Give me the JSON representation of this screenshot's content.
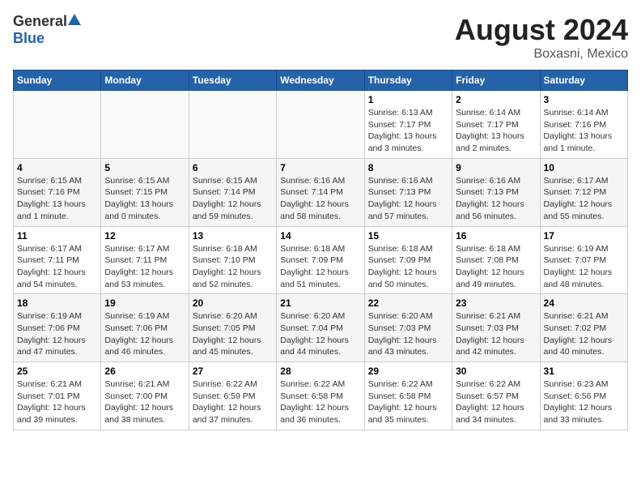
{
  "header": {
    "logo_general": "General",
    "logo_blue": "Blue",
    "month": "August 2024",
    "location": "Boxasni, Mexico"
  },
  "weekdays": [
    "Sunday",
    "Monday",
    "Tuesday",
    "Wednesday",
    "Thursday",
    "Friday",
    "Saturday"
  ],
  "weeks": [
    [
      {
        "day": "",
        "info": ""
      },
      {
        "day": "",
        "info": ""
      },
      {
        "day": "",
        "info": ""
      },
      {
        "day": "",
        "info": ""
      },
      {
        "day": "1",
        "info": "Sunrise: 6:13 AM\nSunset: 7:17 PM\nDaylight: 13 hours\nand 3 minutes."
      },
      {
        "day": "2",
        "info": "Sunrise: 6:14 AM\nSunset: 7:17 PM\nDaylight: 13 hours\nand 2 minutes."
      },
      {
        "day": "3",
        "info": "Sunrise: 6:14 AM\nSunset: 7:16 PM\nDaylight: 13 hours\nand 1 minute."
      }
    ],
    [
      {
        "day": "4",
        "info": "Sunrise: 6:15 AM\nSunset: 7:16 PM\nDaylight: 13 hours\nand 1 minute."
      },
      {
        "day": "5",
        "info": "Sunrise: 6:15 AM\nSunset: 7:15 PM\nDaylight: 13 hours\nand 0 minutes."
      },
      {
        "day": "6",
        "info": "Sunrise: 6:15 AM\nSunset: 7:14 PM\nDaylight: 12 hours\nand 59 minutes."
      },
      {
        "day": "7",
        "info": "Sunrise: 6:16 AM\nSunset: 7:14 PM\nDaylight: 12 hours\nand 58 minutes."
      },
      {
        "day": "8",
        "info": "Sunrise: 6:16 AM\nSunset: 7:13 PM\nDaylight: 12 hours\nand 57 minutes."
      },
      {
        "day": "9",
        "info": "Sunrise: 6:16 AM\nSunset: 7:13 PM\nDaylight: 12 hours\nand 56 minutes."
      },
      {
        "day": "10",
        "info": "Sunrise: 6:17 AM\nSunset: 7:12 PM\nDaylight: 12 hours\nand 55 minutes."
      }
    ],
    [
      {
        "day": "11",
        "info": "Sunrise: 6:17 AM\nSunset: 7:11 PM\nDaylight: 12 hours\nand 54 minutes."
      },
      {
        "day": "12",
        "info": "Sunrise: 6:17 AM\nSunset: 7:11 PM\nDaylight: 12 hours\nand 53 minutes."
      },
      {
        "day": "13",
        "info": "Sunrise: 6:18 AM\nSunset: 7:10 PM\nDaylight: 12 hours\nand 52 minutes."
      },
      {
        "day": "14",
        "info": "Sunrise: 6:18 AM\nSunset: 7:09 PM\nDaylight: 12 hours\nand 51 minutes."
      },
      {
        "day": "15",
        "info": "Sunrise: 6:18 AM\nSunset: 7:09 PM\nDaylight: 12 hours\nand 50 minutes."
      },
      {
        "day": "16",
        "info": "Sunrise: 6:18 AM\nSunset: 7:08 PM\nDaylight: 12 hours\nand 49 minutes."
      },
      {
        "day": "17",
        "info": "Sunrise: 6:19 AM\nSunset: 7:07 PM\nDaylight: 12 hours\nand 48 minutes."
      }
    ],
    [
      {
        "day": "18",
        "info": "Sunrise: 6:19 AM\nSunset: 7:06 PM\nDaylight: 12 hours\nand 47 minutes."
      },
      {
        "day": "19",
        "info": "Sunrise: 6:19 AM\nSunset: 7:06 PM\nDaylight: 12 hours\nand 46 minutes."
      },
      {
        "day": "20",
        "info": "Sunrise: 6:20 AM\nSunset: 7:05 PM\nDaylight: 12 hours\nand 45 minutes."
      },
      {
        "day": "21",
        "info": "Sunrise: 6:20 AM\nSunset: 7:04 PM\nDaylight: 12 hours\nand 44 minutes."
      },
      {
        "day": "22",
        "info": "Sunrise: 6:20 AM\nSunset: 7:03 PM\nDaylight: 12 hours\nand 43 minutes."
      },
      {
        "day": "23",
        "info": "Sunrise: 6:21 AM\nSunset: 7:03 PM\nDaylight: 12 hours\nand 42 minutes."
      },
      {
        "day": "24",
        "info": "Sunrise: 6:21 AM\nSunset: 7:02 PM\nDaylight: 12 hours\nand 40 minutes."
      }
    ],
    [
      {
        "day": "25",
        "info": "Sunrise: 6:21 AM\nSunset: 7:01 PM\nDaylight: 12 hours\nand 39 minutes."
      },
      {
        "day": "26",
        "info": "Sunrise: 6:21 AM\nSunset: 7:00 PM\nDaylight: 12 hours\nand 38 minutes."
      },
      {
        "day": "27",
        "info": "Sunrise: 6:22 AM\nSunset: 6:59 PM\nDaylight: 12 hours\nand 37 minutes."
      },
      {
        "day": "28",
        "info": "Sunrise: 6:22 AM\nSunset: 6:58 PM\nDaylight: 12 hours\nand 36 minutes."
      },
      {
        "day": "29",
        "info": "Sunrise: 6:22 AM\nSunset: 6:58 PM\nDaylight: 12 hours\nand 35 minutes."
      },
      {
        "day": "30",
        "info": "Sunrise: 6:22 AM\nSunset: 6:57 PM\nDaylight: 12 hours\nand 34 minutes."
      },
      {
        "day": "31",
        "info": "Sunrise: 6:23 AM\nSunset: 6:56 PM\nDaylight: 12 hours\nand 33 minutes."
      }
    ]
  ]
}
